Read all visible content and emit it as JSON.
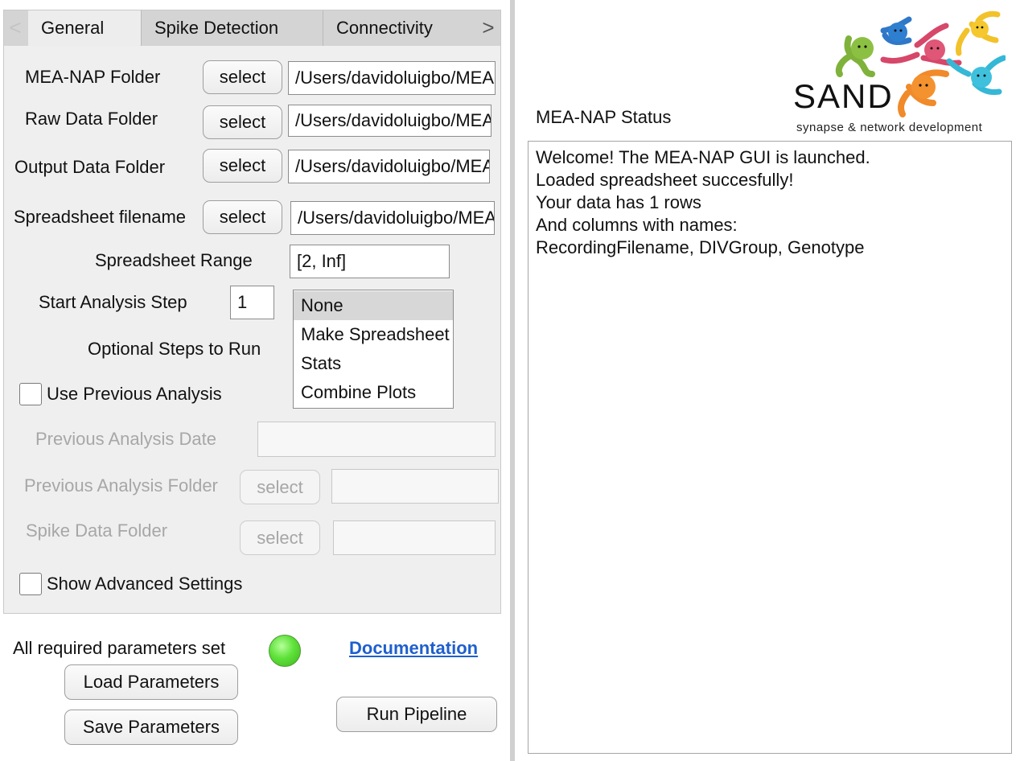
{
  "tabs": {
    "prev_arrow": "<",
    "next_arrow": ">",
    "items": [
      {
        "label": "General",
        "active": true
      },
      {
        "label": "Spike Detection",
        "active": false
      },
      {
        "label": "Connectivity",
        "active": false
      }
    ]
  },
  "general": {
    "select_label": "select",
    "mea_nap_folder": {
      "label": "MEA-NAP Folder",
      "value": "/Users/davidoluigbo/MEA-NAP"
    },
    "raw_data_folder": {
      "label": "Raw Data Folder",
      "value": "/Users/davidoluigbo/MEA-NAP"
    },
    "output_data_folder": {
      "label": "Output Data Folder",
      "value": "/Users/davidoluigbo/MEA-NAP"
    },
    "spreadsheet_filename": {
      "label": "Spreadsheet filename",
      "value": "/Users/davidoluigbo/MEA-NAP"
    },
    "spreadsheet_range": {
      "label": "Spreadsheet Range",
      "value": "[2, Inf]"
    },
    "start_analysis_step": {
      "label": "Start Analysis Step",
      "value": "1"
    },
    "optional_steps": {
      "label": "Optional Steps to Run",
      "options": [
        "None",
        "Make Spreadsheet",
        "Stats",
        "Combine Plots"
      ],
      "selected": "None"
    },
    "use_previous_analysis": {
      "label": "Use Previous Analysis",
      "checked": false
    },
    "previous_analysis_date": {
      "label": "Previous Analysis Date",
      "value": ""
    },
    "previous_analysis_folder": {
      "label": "Previous Analysis Folder",
      "value": ""
    },
    "spike_data_folder": {
      "label": "Spike Data Folder",
      "value": ""
    },
    "show_advanced_settings": {
      "label": "Show Advanced Settings",
      "checked": false
    }
  },
  "footer": {
    "params_status_label": "All required parameters set",
    "status_color": "#5fe23a",
    "documentation_link": "Documentation",
    "load_parameters": "Load Parameters",
    "save_parameters": "Save Parameters",
    "run_pipeline": "Run Pipeline"
  },
  "status_panel": {
    "title": "MEA-NAP Status",
    "lines": [
      "Welcome! The MEA-NAP GUI is launched.",
      "Loaded spreadsheet succesfully!",
      "Your data has 1 rows",
      "And columns with names:",
      "RecordingFilename, DIVGroup, Genotype"
    ]
  },
  "logo": {
    "text": "SAND",
    "tagline": "synapse & network development"
  }
}
